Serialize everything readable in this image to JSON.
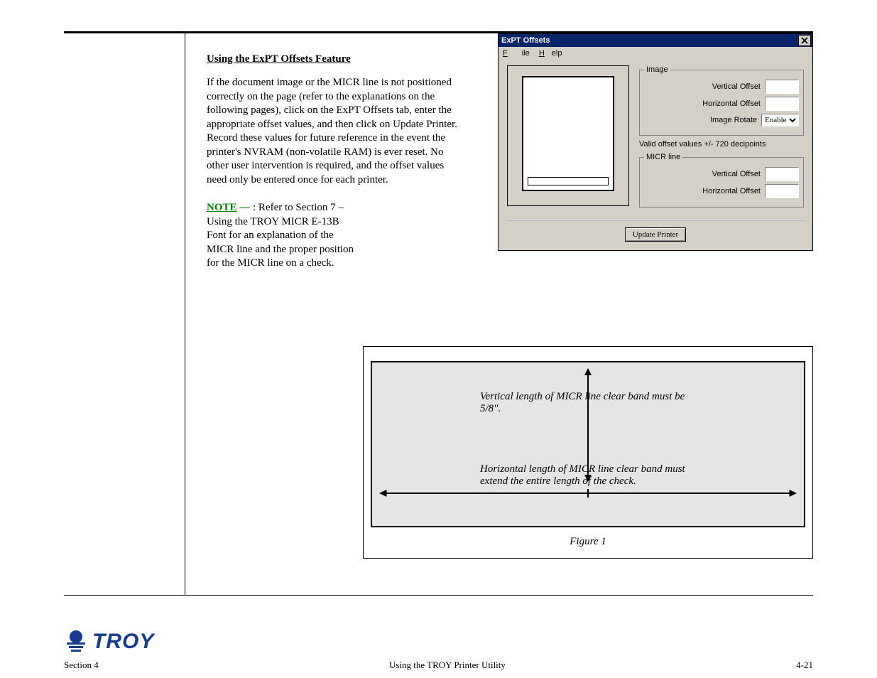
{
  "section": {
    "heading": "Using the ExPT Offsets Feature",
    "para": "If the document image or the MICR line is not positioned correctly on the page (refer to the explanations on the following pages), click on the ExPT Offsets tab, enter the appropriate offset values, and then click on Update Printer. Record these values for future reference in the event the printer's NVRAM (non-volatile RAM) is ever reset. No other user intervention is required, and the offset values need only be entered once for each printer.",
    "note_label": "NOTE",
    "note_body": ": Refer to Section 7 – Using the TROY MICR E-13B Font for an explanation of the MICR line and the proper position for the MICR line on a check."
  },
  "dialog": {
    "title": "ExPT Offsets",
    "menu_file": "File",
    "menu_help": "Help",
    "grp_image": "Image",
    "grp_micr": "MICR line",
    "vert_label": "Vertical Offset",
    "horz_label": "Horizontal Offset",
    "rotate_label": "Image Rotate",
    "rotate_value": "Enable",
    "hint": "Valid offset values +/- 720 decipoints",
    "button": "Update Printer"
  },
  "fig": {
    "vert": "Vertical length of MICR line clear band must be 5/8\".",
    "horz": "Horizontal length of MICR line clear band must extend the entire length of the check.",
    "caption": "Figure 1"
  },
  "footer": {
    "left": "Section 4",
    "center": "Using the TROY Printer Utility",
    "pgnum": "4-21",
    "brand": "TROY"
  }
}
